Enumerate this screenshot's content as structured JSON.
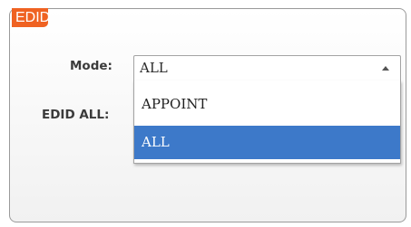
{
  "panel": {
    "tab_label": "EDID"
  },
  "form": {
    "mode_label": "Mode:",
    "edid_all_label": "EDID ALL:"
  },
  "mode_select": {
    "selected_value": "ALL",
    "options": [
      {
        "label": "APPOINT",
        "selected": false
      },
      {
        "label": "ALL",
        "selected": true
      }
    ]
  },
  "colors": {
    "tab_orange": "#ef6222",
    "selection_blue": "#3d79c9",
    "border_gray": "#9a9a9a"
  },
  "icons": {
    "dropdown_arrow": "chevron-up-icon"
  }
}
